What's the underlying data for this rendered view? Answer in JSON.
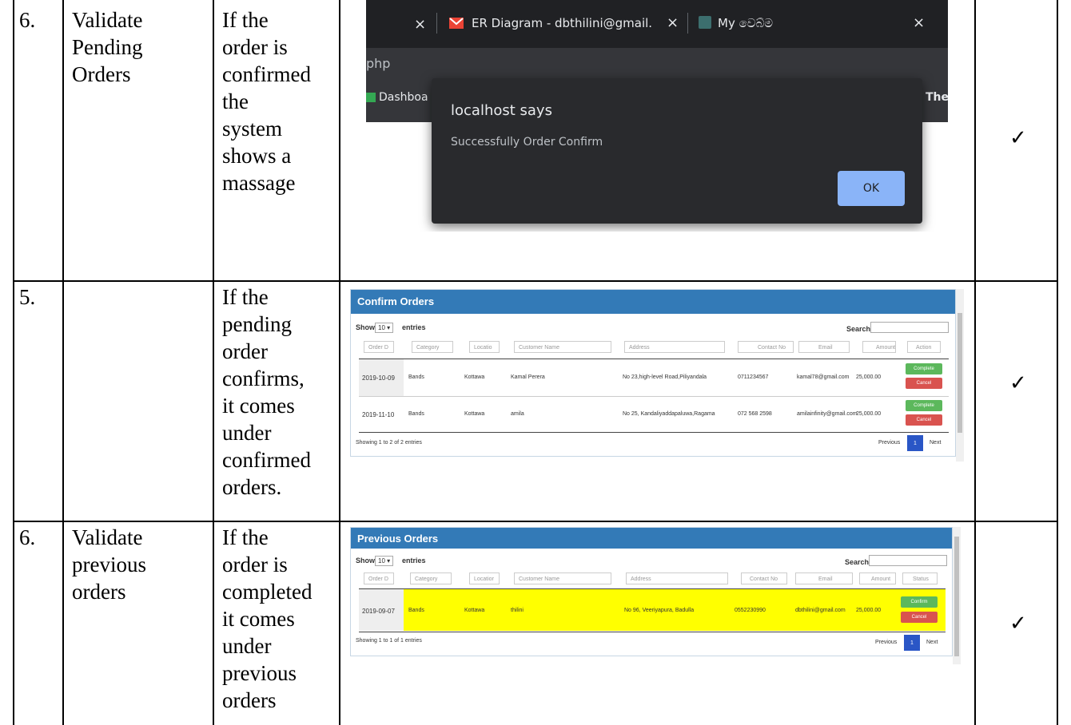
{
  "rows": [
    {
      "no": "6.",
      "name": "Validate\nPending\nOrders",
      "description": "If the\norder is\nconfirmed\nthe\nsystem\nshows a\nmassage",
      "result": "✓"
    },
    {
      "no": "5.",
      "name": "",
      "description": "If the\npending\norder\nconfirms,\nit comes\nunder\nconfirmed\norders.",
      "result": "✓"
    },
    {
      "no": "6.",
      "name": "Validate\nprevious\norders",
      "description": "If the\norder is\ncompleted\nit comes\nunder\nprevious\norders",
      "result": "✓"
    }
  ],
  "browser_shot": {
    "tab1_close": "×",
    "tab2_title": "ER Diagram - dbthilini@gmail.",
    "tab2_close": "×",
    "tab3_title": "My වෙබ්ම",
    "tab3_close": "×",
    "url_fragment": "php",
    "bookmark_left": "Dashboa",
    "bookmark_right": "The :",
    "dialog": {
      "title": "localhost says",
      "message": "Successfully Order Confirm",
      "ok_label": "OK"
    },
    "colors": {
      "tabbar": "#202124",
      "dialog": "#292a2d",
      "ok_button": "#8ab4f8"
    }
  },
  "confirm_orders": {
    "title": "Confirm Orders",
    "show_label": "Show",
    "show_value": "10",
    "entries_label": "entries",
    "search_label": "Search:",
    "columns": [
      "Order D",
      "Category",
      "Locatio",
      "Customer Name",
      "Address",
      "Contact No",
      "Email",
      "Amount",
      "Action"
    ],
    "rows": [
      {
        "date": "2019-10-09",
        "category": "Bands",
        "location": "Kottawa",
        "customer": "Kamal Perera",
        "address": "No 23,high-level Road,Piliyandala",
        "contact": "0711234567",
        "email": "kamal78@gmail.com",
        "amount": "25,000.00",
        "btn1": "Complete",
        "btn2": "Cancel"
      },
      {
        "date": "2019-11-10",
        "category": "Bands",
        "location": "Kottawa",
        "customer": "amila",
        "address": "No 25, Kandaliyaddapaluwa,Ragama",
        "contact": "072 568 2598",
        "email": "amilainfinity@gmail.com",
        "amount": "25,000.00",
        "btn1": "Complete",
        "btn2": "Cancel"
      }
    ],
    "footer": "Showing 1 to 2 of 2 entries",
    "prev_label": "Previous",
    "page_label": "1",
    "next_label": "Next"
  },
  "previous_orders": {
    "title": "Previous Orders",
    "show_label": "Show",
    "show_value": "10",
    "entries_label": "entries",
    "search_label": "Search:",
    "columns": [
      "Order D",
      "Category",
      "Locatior",
      "Customer Name",
      "Address",
      "Contact No",
      "Email",
      "Amount",
      "Status"
    ],
    "rows": [
      {
        "date": "2019-09-07",
        "category": "Bands",
        "location": "Kottawa",
        "customer": "thilini",
        "address": "No 96, Veeriyapura, Badulla",
        "contact": "0552230990",
        "email": "dbthilini@gmail.com",
        "amount": "25,000.00",
        "btn1": "Confirm",
        "btn2": "Cancel"
      }
    ],
    "footer": "Showing 1 to 1 of 1 entries",
    "prev_label": "Previous",
    "page_label": "1",
    "next_label": "Next",
    "highlight_color": "#ffff00"
  }
}
